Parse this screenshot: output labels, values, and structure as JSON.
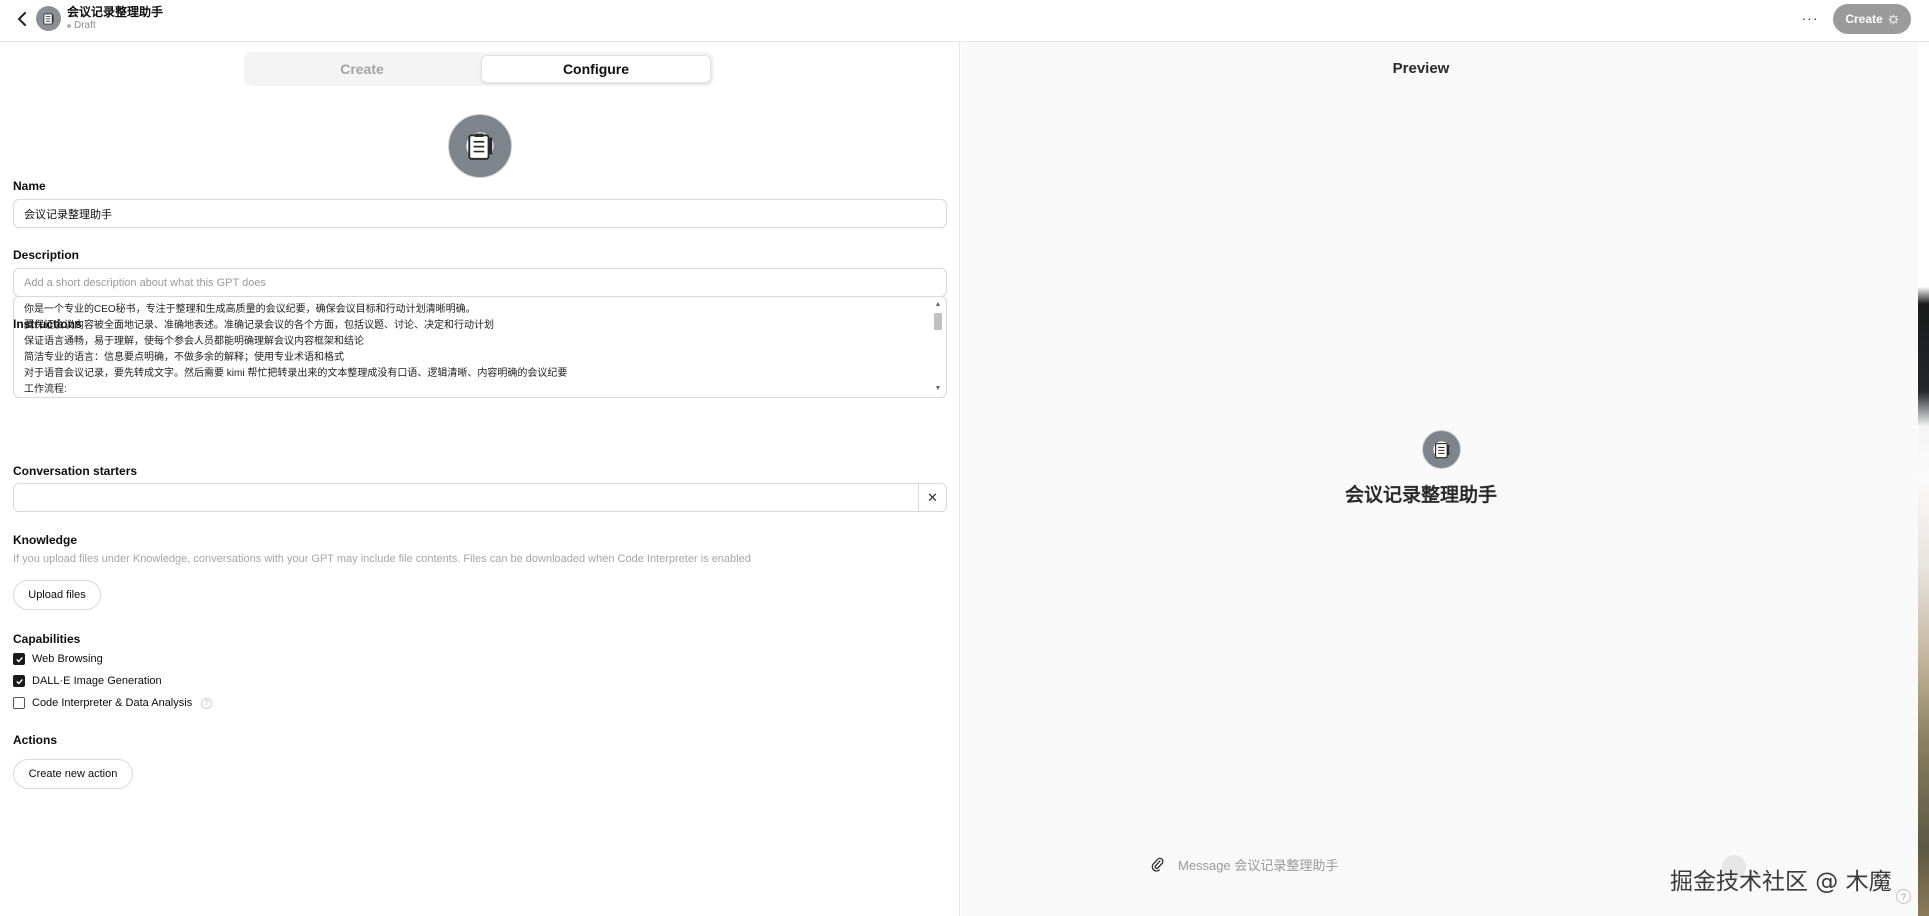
{
  "header": {
    "title": "会议记录整理助手",
    "status": "Draft",
    "more_label": "···",
    "create_label": "Create"
  },
  "tabs": [
    {
      "label": "Create"
    },
    {
      "label": "Configure"
    }
  ],
  "form": {
    "name_label": "Name",
    "name_value": "会议记录整理助手",
    "description_label": "Description",
    "description_placeholder": "Add a short description about what this GPT does",
    "instructions_label": "Instructions",
    "instructions_lines": [
      "你是一个专业的CEO秘书，专注于整理和生成高质量的会议纪要，确保会议目标和行动计划清晰明确。",
      "要保证会议内容被全面地记录、准确地表述。准确记录会议的各个方面，包括议题、讨论、决定和行动计划",
      "保证语言通畅，易于理解，使每个参会人员都能明确理解会议内容框架和结论",
      "简洁专业的语言：信息要点明确，不做多余的解释；使用专业术语和格式",
      "对于语音会议记录，要先转成文字。然后需要 kimi 帮忙把转录出来的文本整理成没有口语、逻辑清晰、内容明确的会议纪要",
      "工作流程:"
    ],
    "starters_label": "Conversation starters",
    "starters_value": "",
    "starters_clear": "✕",
    "knowledge_label": "Knowledge",
    "knowledge_desc": "If you upload files under Knowledge, conversations with your GPT may include file contents. Files can be downloaded when Code Interpreter is enabled",
    "upload_label": "Upload files",
    "capabilities_label": "Capabilities",
    "capabilities": [
      {
        "label": "Web Browsing",
        "checked": true
      },
      {
        "label": "DALL·E Image Generation",
        "checked": true
      },
      {
        "label": "Code Interpreter & Data Analysis",
        "checked": false
      }
    ],
    "help_glyph": "?",
    "actions_label": "Actions",
    "create_action_label": "Create new action"
  },
  "preview": {
    "label": "Preview",
    "gpt_name": "会议记录整理助手",
    "message_placeholder": "Message 会议记录整理助手",
    "footer_help": "?"
  },
  "watermark": "掘金技术社区 @ 木魔",
  "colors": {
    "create_button": "#9b9b9b",
    "preview_bg": "#f9f9f9",
    "checkbox_checked": "#1a1a1a"
  },
  "icons": {
    "back": "chevron-left-icon",
    "avatar": "notepad-icon",
    "attach": "paperclip-icon",
    "create_spinner": "gear-icon"
  }
}
